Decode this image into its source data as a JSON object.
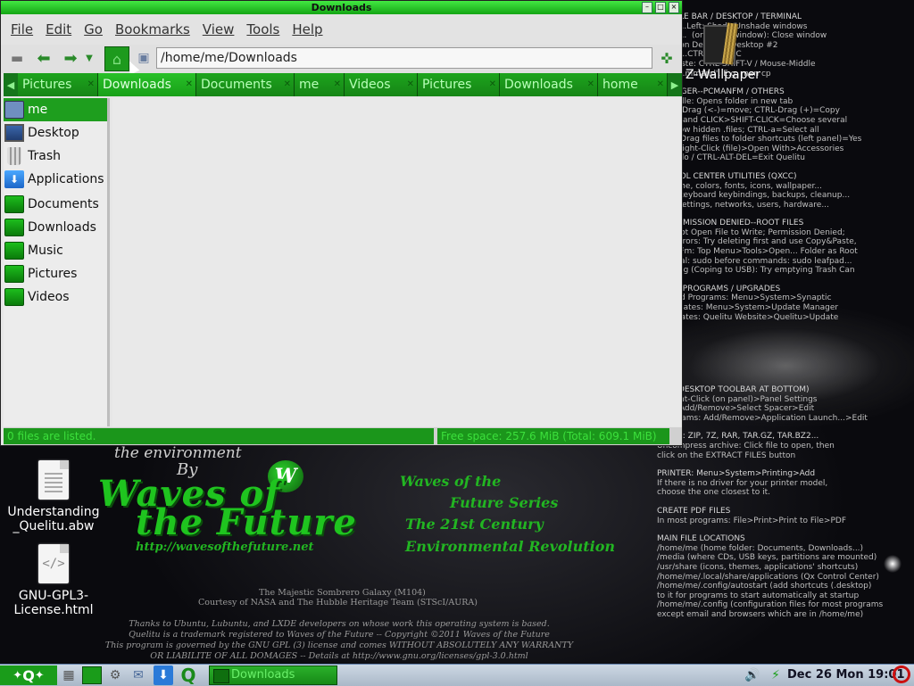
{
  "window": {
    "title": "Downloads",
    "menu": [
      "File",
      "Edit",
      "Go",
      "Bookmarks",
      "View",
      "Tools",
      "Help"
    ],
    "path": "/home/me/Downloads",
    "tabs": [
      "Pictures",
      "Downloads",
      "Documents",
      "me",
      "Videos",
      "Pictures",
      "Downloads",
      "home"
    ],
    "active_tab": 1,
    "sidebar": [
      {
        "label": "me",
        "icon": "home-folder-icon"
      },
      {
        "label": "Desktop",
        "icon": "desktop-icon"
      },
      {
        "label": "Trash",
        "icon": "trash-icon"
      },
      {
        "label": "Applications",
        "icon": "applications-icon"
      },
      {
        "label": "Documents",
        "icon": "folder-icon"
      },
      {
        "label": "Downloads",
        "icon": "folder-icon"
      },
      {
        "label": "Music",
        "icon": "folder-icon"
      },
      {
        "label": "Pictures",
        "icon": "folder-icon"
      },
      {
        "label": "Videos",
        "icon": "folder-icon"
      }
    ],
    "status_left": "0 files are listed.",
    "status_right": "Free space: 257.6 MiB (Total: 609.1 MiB)",
    "accent": "#1e9e1e"
  },
  "desktop": {
    "icons": [
      {
        "label": "Understanding\n_Quelitu.abw",
        "icon": "document-icon"
      },
      {
        "label": "GNU-GPL3-\nLicense.html",
        "icon": "html-file-icon"
      },
      {
        "label": "Z-Wallpaper",
        "icon": "wallpaper-icon"
      }
    ],
    "help_upper": [
      {
        "t": "S--TITLE BAR / DESKTOP / TERMINAL",
        "h": true
      },
      {
        "t": "   Mou..Left: Shade/Unshade windows"
      },
      {
        "t": "   Mou..  (or F12 in window): Close window"
      },
      {
        "t": "p: ..ll on Desktop: Desktop #2"
      },
      {
        "t": "al Cop..CTRL-SHIFT-C"
      },
      {
        "t": "nal Paste: CTRL-SHIFT-V / Mouse-Middle"
      },
      {
        "t": "         ..mmand'. E.g. man cp"
      },
      {
        "t": "",
        "g": true
      },
      {
        "t": "MANAGER--PCMANFM / OTHERS",
        "h": true
      },
      {
        "t": "e-Middle: Opens folder in new tab"
      },
      {
        "t": "SHIFT-Drag (<-)=move; CTRL-Drag (+)=Copy"
      },
      {
        "t": "CLICK and CLICK>SHIFT-CLICK=Choose several"
      },
      {
        "t": "h=Show hidden .files; CTRL-a=Select all"
      },
      {
        "t": "CTRL-Drag files to folder shortcuts (left panel)=Yes"
      },
      {
        "t": "lets: Right-Click (file)>Open With>Accessories"
      },
      {
        "t": "z=Undo / CTRL-ALT-DEL=Exit Quelitu"
      },
      {
        "t": "",
        "g": true
      },
      {
        "t": "ONTROL CENTER UTILITIES (QXCC)",
        "h": true
      },
      {
        "t": "e theme, colors, fonts, icons, wallpaper..."
      },
      {
        "t": "cuts, keyboard keybindings, backups, cleanup..."
      },
      {
        "t": "gure settings, networks, users, hardware..."
      },
      {
        "t": "",
        "g": true
      },
      {
        "t": "S: PERMISSION DENIED--ROOT FILES",
        "h": true
      },
      {
        "t": " Cannot Open File to Write; Permission Denied;"
      },
      {
        "t": "apy Errors: Try deleting first and use Copy&Paste,"
      },
      {
        "t": "CManFm: Top Menu>Tools>Open... Folder as Root"
      },
      {
        "t": "erminal: sudo before commands: sudo leafpad..."
      },
      {
        "t": "Splicing (Coping to USB): Try emptying Trash Can"
      },
      {
        "t": "",
        "g": true
      },
      {
        "t": "/ ADD PROGRAMS / UPGRADES",
        "h": true
      },
      {
        "t": "nd Add Programs: Menu>System>Synaptic"
      },
      {
        "t": "m Updates: Menu>System>Update Manager"
      },
      {
        "t": "u Updates: Quelitu Website>Quelitu>Update"
      }
    ],
    "help_lower": [
      {
        "t": "BEE (DESKTOP TOOLBAR AT BOTTOM)",
        "h": true
      },
      {
        "t": "s: Right-Click (on panel)>Panel Settings"
      },
      {
        "t": "   ..s: Add/Remove>Select Spacer>Edit"
      },
      {
        "t": "   ..rgrams: Add/Remove>Application Launch...>Edit"
      },
      {
        "t": "",
        "g": true
      },
      {
        "t": "OLLER: ZIP, 7Z, RAR, TAR.GZ, TAR.BZ2...",
        "h": true
      },
      {
        "t": "Uncompress archive: Click file to open, then"
      },
      {
        "t": "click on the EXTRACT FILES button"
      },
      {
        "t": "",
        "g": true
      },
      {
        "t": "PRINTER: Menu>System>Printing>Add",
        "h": true
      },
      {
        "t": "If there is no driver for your printer model,"
      },
      {
        "t": "choose the one closest to it."
      },
      {
        "t": "",
        "g": true
      },
      {
        "t": "CREATE PDF FILES",
        "h": true
      },
      {
        "t": "In most programs: File>Print>Print to File>PDF"
      },
      {
        "t": "",
        "g": true
      },
      {
        "t": "MAIN FILE LOCATIONS",
        "h": true
      },
      {
        "t": "/home/me (home folder: Documents, Downloads...)"
      },
      {
        "t": "/media (where CDs, USB keys, partitions are mounted)"
      },
      {
        "t": "/usr/share (icons, themes, applications' shortcuts)"
      },
      {
        "t": "/home/me/.local/share/applications (Qx Control Center)"
      },
      {
        "t": "/home/me/.config/autostart (add shortcuts (.desktop)"
      },
      {
        "t": "to it for programs to start automatically at startup"
      },
      {
        "t": "/home/me/.config (configuration files for most programs"
      },
      {
        "t": "except email and browsers which are in /home/me)"
      }
    ],
    "wallpaper": {
      "env": "the environment",
      "by": "By",
      "logo": "W",
      "big1": "Waves of",
      "big2": "the Future",
      "url": "http://wavesofthefuture.net",
      "r1": "Waves of the",
      "r2": "Future Series",
      "r3": "The 21st Century",
      "r4": "Environmental Revolution",
      "s1": "The Majestic Sombrero Galaxy (M104)",
      "s2": "Courtesy of NASA and The Hubble Heritage Team (STScI/AURA)",
      "s3": "Thanks to Ubuntu, Lubuntu, and LXDE developers on whose work this operating system is based.\nQuelitu is a trademark registered to Waves of the Future  --  Copyright ©2011  Waves of the Future\nThis program is governed by the GNU GPL (3) license and comes WITHOUT ABSOLUTELY ANY WARRANTY\nOR LIABILITE OF ALL DOMAGES -- Details at http://www.gnu.org/licenses/gpl-3.0.html"
    }
  },
  "taskbar": {
    "start_label": "Q",
    "task": "Downloads",
    "clock": "Dec 26 Mon 19:01"
  }
}
